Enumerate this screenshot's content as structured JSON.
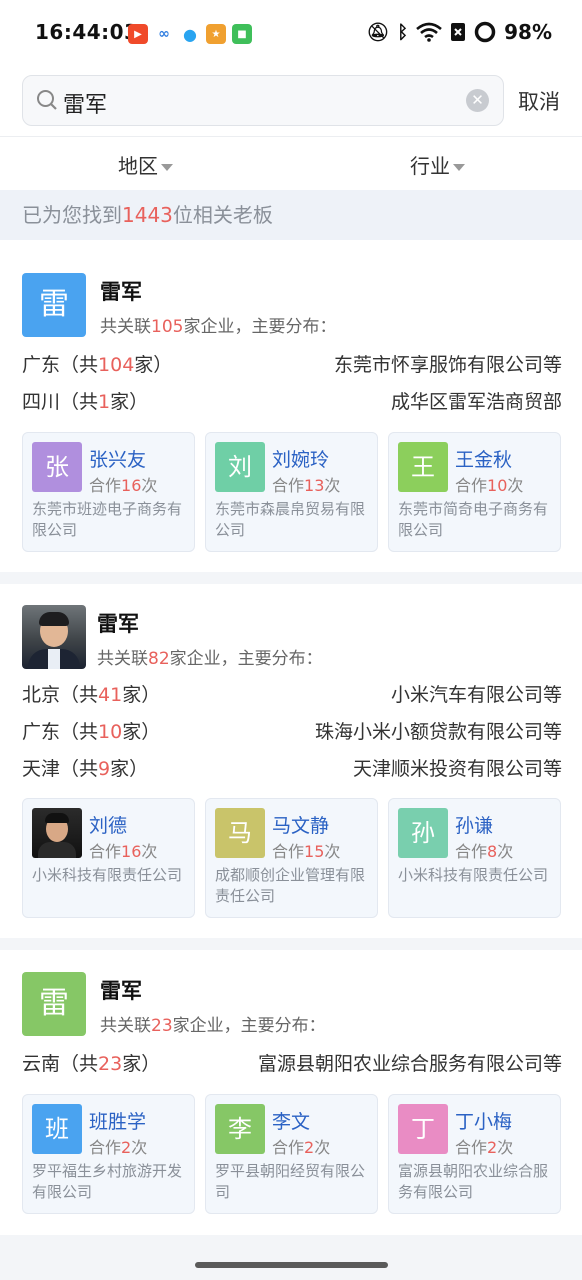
{
  "status_bar": {
    "time": "16:44:03",
    "battery": "98%",
    "app_icons": [
      "youtube-icon",
      "cloud-icon",
      "qq-icon",
      "game-icon",
      "store-icon"
    ]
  },
  "search": {
    "query": "雷军",
    "cancel_label": "取消"
  },
  "filters": {
    "region_label": "地区",
    "industry_label": "行业"
  },
  "result": {
    "prefix": "已为您找到",
    "count": "1443",
    "suffix": "位相关老板"
  },
  "cards": [
    {
      "avatar_char": "雷",
      "avatar_color": "#4aa3f0",
      "name": "雷军",
      "summary_prefix": "共关联",
      "summary_count": "105",
      "summary_suffix": "家企业，主要分布：",
      "distribution": [
        {
          "region_prefix": "广东（共",
          "count": "104",
          "region_suffix": "家）",
          "company": "东莞市怀享服饰有限公司等"
        },
        {
          "region_prefix": "四川（共",
          "count": "1",
          "region_suffix": "家）",
          "company": "成华区雷军浩商贸部"
        }
      ],
      "partners": [
        {
          "char": "张",
          "color": "#b08fde",
          "name": "张兴友",
          "times_prefix": "合作",
          "times": "16",
          "times_suffix": "次",
          "company": "东莞市班迹电子商务有限公司"
        },
        {
          "char": "刘",
          "color": "#6fcfa6",
          "name": "刘婉玲",
          "times_prefix": "合作",
          "times": "13",
          "times_suffix": "次",
          "company": "东莞市森晨帛贸易有限公司"
        },
        {
          "char": "王",
          "color": "#8ccf5c",
          "name": "王金秋",
          "times_prefix": "合作",
          "times": "10",
          "times_suffix": "次",
          "company": "东莞市简奇电子商务有限公司"
        }
      ]
    },
    {
      "name": "雷军",
      "summary_prefix": "共关联",
      "summary_count": "82",
      "summary_suffix": "家企业，主要分布：",
      "distribution": [
        {
          "region_prefix": "北京（共",
          "count": "41",
          "region_suffix": "家）",
          "company": "小米汽车有限公司等"
        },
        {
          "region_prefix": "广东（共",
          "count": "10",
          "region_suffix": "家）",
          "company": "珠海小米小额贷款有限公司等"
        },
        {
          "region_prefix": "天津（共",
          "count": "9",
          "region_suffix": "家）",
          "company": "天津顺米投资有限公司等"
        }
      ],
      "partners": [
        {
          "name": "刘德",
          "times_prefix": "合作",
          "times": "16",
          "times_suffix": "次",
          "company": "小米科技有限责任公司"
        },
        {
          "char": "马",
          "color": "#c9c46a",
          "name": "马文静",
          "times_prefix": "合作",
          "times": "15",
          "times_suffix": "次",
          "company": "成都顺创企业管理有限责任公司"
        },
        {
          "char": "孙",
          "color": "#79cfae",
          "name": "孙谦",
          "times_prefix": "合作",
          "times": "8",
          "times_suffix": "次",
          "company": "小米科技有限责任公司"
        }
      ]
    },
    {
      "avatar_char": "雷",
      "avatar_color": "#86c766",
      "name": "雷军",
      "summary_prefix": "共关联",
      "summary_count": "23",
      "summary_suffix": "家企业，主要分布：",
      "distribution": [
        {
          "region_prefix": "云南（共",
          "count": "23",
          "region_suffix": "家）",
          "company": "富源县朝阳农业综合服务有限公司等"
        }
      ],
      "partners": [
        {
          "char": "班",
          "color": "#4aa3f0",
          "name": "班胜学",
          "times_prefix": "合作",
          "times": "2",
          "times_suffix": "次",
          "company": "罗平福生乡村旅游开发有限公司"
        },
        {
          "char": "李",
          "color": "#86c766",
          "name": "李文",
          "times_prefix": "合作",
          "times": "2",
          "times_suffix": "次",
          "company": "罗平县朝阳经贸有限公司"
        },
        {
          "char": "丁",
          "color": "#e98cc4",
          "name": "丁小梅",
          "times_prefix": "合作",
          "times": "2",
          "times_suffix": "次",
          "company": "富源县朝阳农业综合服务有限公司"
        }
      ]
    }
  ]
}
